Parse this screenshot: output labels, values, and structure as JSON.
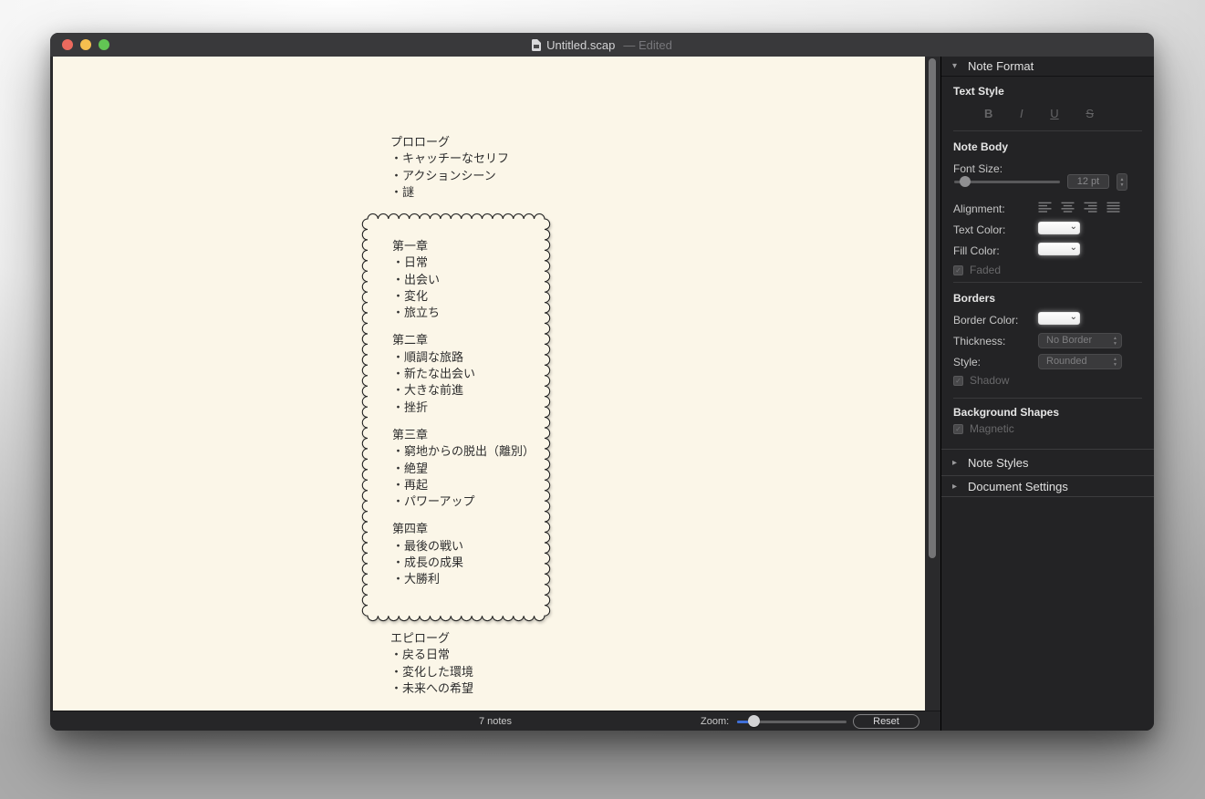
{
  "colors": {
    "canvas_bg": "#FBF6E8",
    "sidebar_bg": "#232325",
    "titlebar_bg": "#39393B",
    "statusbar_bg": "#262628",
    "accent_blue": "#3E6ED8",
    "traffic_red": "#EC6A5E",
    "traffic_yellow": "#F5BF4F",
    "traffic_green": "#62C554",
    "note_text": "#2E2E2E"
  },
  "icons": {
    "disclosure_open": "▾",
    "disclosure_closed": "▸",
    "color_well_chevron": "⌄",
    "stepper_up": "▲",
    "stepper_down": "▼",
    "checkbox_check": "✓"
  },
  "titlebar": {
    "filename": "Untitled.scap",
    "edited": "— Edited"
  },
  "canvas": {
    "prologue": {
      "lines": [
        "プロローグ",
        "・キャッチーなセリフ",
        "・アクションシーン",
        "・謎"
      ]
    },
    "chapters": [
      {
        "lines": [
          "第一章",
          "・日常",
          "・出会い",
          "・変化",
          "・旅立ち"
        ]
      },
      {
        "lines": [
          "第二章",
          "・順調な旅路",
          "・新たな出会い",
          "・大きな前進",
          "・挫折"
        ]
      },
      {
        "lines": [
          "第三章",
          "・窮地からの脱出（離別）",
          "・絶望",
          "・再起",
          "・パワーアップ"
        ]
      },
      {
        "lines": [
          "第四章",
          "・最後の戦い",
          "・成長の成果",
          "・大勝利"
        ]
      }
    ],
    "epilogue": {
      "lines": [
        "エピローグ",
        "・戻る日常",
        "・変化した環境",
        "・未来への希望"
      ]
    }
  },
  "inspector": {
    "note_format": {
      "label": "Note Format"
    },
    "text_style": {
      "label": "Text Style",
      "bold": "B",
      "italic": "I",
      "underline": "U",
      "strikethrough": "S"
    },
    "note_body": {
      "label": "Note Body",
      "font_size_label": "Font Size:",
      "font_size_value": "12 pt",
      "alignment_label": "Alignment:",
      "text_color_label": "Text Color:",
      "fill_color_label": "Fill Color:",
      "faded_label": "Faded"
    },
    "borders": {
      "label": "Borders",
      "border_color_label": "Border Color:",
      "thickness_label": "Thickness:",
      "thickness_value": "No Border",
      "style_label": "Style:",
      "style_value": "Rounded",
      "shadow_label": "Shadow"
    },
    "background_shapes": {
      "label": "Background Shapes",
      "magnetic_label": "Magnetic"
    },
    "note_styles": {
      "label": "Note Styles"
    },
    "document_settings": {
      "label": "Document Settings"
    }
  },
  "statusbar": {
    "note_count": "7 notes",
    "zoom_label": "Zoom:",
    "reset_label": "Reset"
  }
}
